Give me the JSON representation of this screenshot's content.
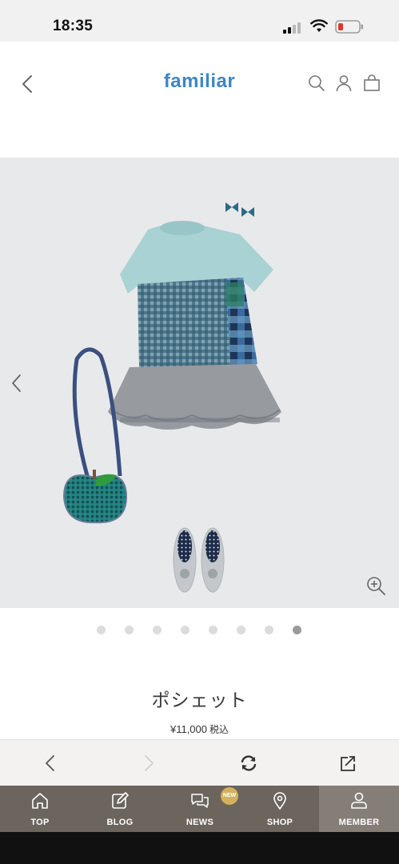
{
  "status_bar": {
    "time": "18:35"
  },
  "header": {
    "logo": "familiar",
    "icons": [
      "back-chevron-icon",
      "search-icon",
      "account-icon",
      "shopping-bag-icon"
    ]
  },
  "gallery": {
    "slide_count": 8,
    "active_slide": 8,
    "icons": [
      "prev-chevron-icon",
      "zoom-in-icon"
    ]
  },
  "product": {
    "name": "ポシェット",
    "price": "¥11,000",
    "tax_label": "税込"
  },
  "browser_toolbar": {
    "icons": [
      "back-arrow-icon",
      "forward-arrow-icon",
      "reload-icon",
      "share-icon"
    ]
  },
  "tabbar": {
    "tabs": [
      {
        "label": "TOP",
        "icon": "home-icon"
      },
      {
        "label": "BLOG",
        "icon": "edit-icon"
      },
      {
        "label": "NEWS",
        "icon": "chat-bubbles-icon",
        "badge": "NEW"
      },
      {
        "label": "SHOP",
        "icon": "location-pin-icon"
      },
      {
        "label": "MEMBER",
        "icon": "member-icon"
      }
    ],
    "active": "MEMBER"
  },
  "colors": {
    "logo": "#3d86c6",
    "tabbar_bg": "#6c655e",
    "tabbar_active": "#857e77",
    "badge": "#d4b15c",
    "battery_low": "#e0362c"
  }
}
